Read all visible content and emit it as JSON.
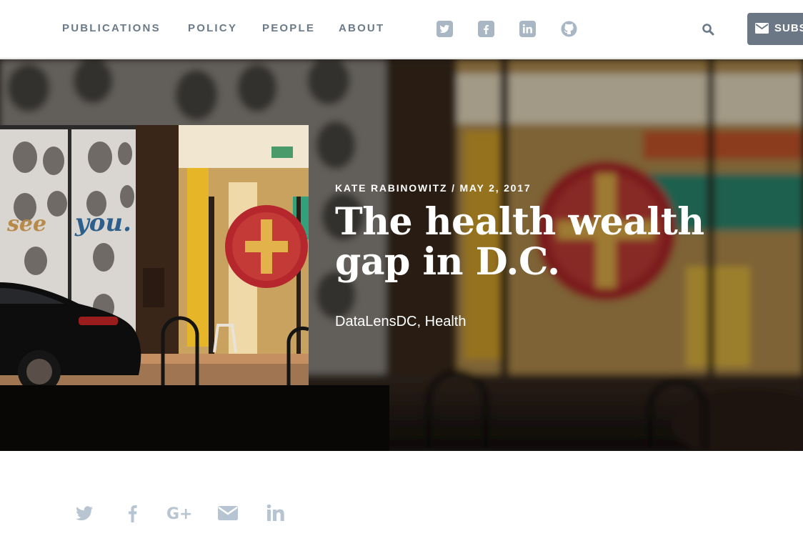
{
  "nav": {
    "links": [
      "PUBLICATIONS",
      "POLICY",
      "PEOPLE",
      "ABOUT"
    ],
    "social_icons": [
      "twitter-icon",
      "facebook-icon",
      "linkedin-icon",
      "github-icon"
    ],
    "search_icon": "search-icon",
    "subscribe_label": "SUBS",
    "subscribe_icon": "envelope-icon"
  },
  "article": {
    "byline": "KATE RABINOWITZ / MAY 2, 2017",
    "title": "The health wealth gap in D.C.",
    "tags": [
      "DataLensDC",
      "Health"
    ],
    "tag_separator": ", "
  },
  "share": {
    "icons": [
      "twitter-share-icon",
      "facebook-share-icon",
      "google-plus-share-icon",
      "email-share-icon",
      "linkedin-share-icon"
    ],
    "google_plus_text": "G+"
  },
  "colors": {
    "nav_text": "#6b7a89",
    "social_icon": "#a9b6c4",
    "subscribe_bg": "#6b7784",
    "share_icon": "#b7c4d1"
  }
}
